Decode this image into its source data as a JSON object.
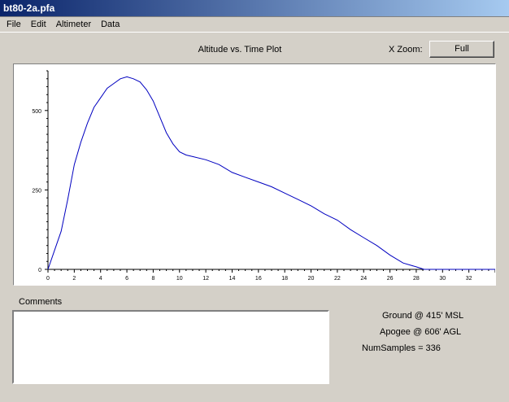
{
  "window": {
    "title": "bt80-2a.pfa"
  },
  "menu": {
    "items": [
      "File",
      "Edit",
      "Altimeter",
      "Data"
    ]
  },
  "plot": {
    "title": "Altitude vs. Time Plot",
    "xzoom_label": "X Zoom:",
    "full_button": "Full",
    "line_color": "#0000c0"
  },
  "comments": {
    "label": "Comments",
    "value": ""
  },
  "info": {
    "ground": "Ground @  415' MSL",
    "apogee": "Apogee @  606' AGL",
    "samples": "NumSamples =  336"
  },
  "chart_data": {
    "type": "line",
    "title": "Altitude vs. Time Plot",
    "xlabel": "",
    "ylabel": "",
    "xlim": [
      0,
      34
    ],
    "ylim": [
      0,
      625
    ],
    "x_ticks": [
      0,
      2,
      4,
      6,
      8,
      10,
      12,
      14,
      16,
      18,
      20,
      22,
      24,
      26,
      28,
      30,
      32
    ],
    "y_ticks": [
      0,
      250,
      500
    ],
    "grid": false,
    "series": [
      {
        "x": [
          0,
          0.5,
          1,
          1.5,
          2,
          2.5,
          3,
          3.5,
          4,
          4.5,
          5,
          5.5,
          6,
          6.5,
          7,
          7.5,
          8,
          8.5,
          9,
          9.5,
          10,
          10.5,
          11,
          12,
          13,
          14,
          15,
          16,
          17,
          18,
          19,
          20,
          21,
          22,
          23,
          24,
          25,
          26,
          27,
          28,
          28.6,
          29,
          30,
          31,
          32,
          34
        ],
        "y": [
          0,
          60,
          120,
          220,
          330,
          400,
          460,
          510,
          540,
          570,
          585,
          600,
          606,
          600,
          590,
          565,
          530,
          480,
          430,
          395,
          370,
          360,
          355,
          345,
          330,
          305,
          290,
          275,
          260,
          240,
          220,
          200,
          175,
          155,
          125,
          100,
          75,
          45,
          20,
          8,
          0,
          0,
          0,
          0,
          0,
          0
        ]
      }
    ]
  }
}
